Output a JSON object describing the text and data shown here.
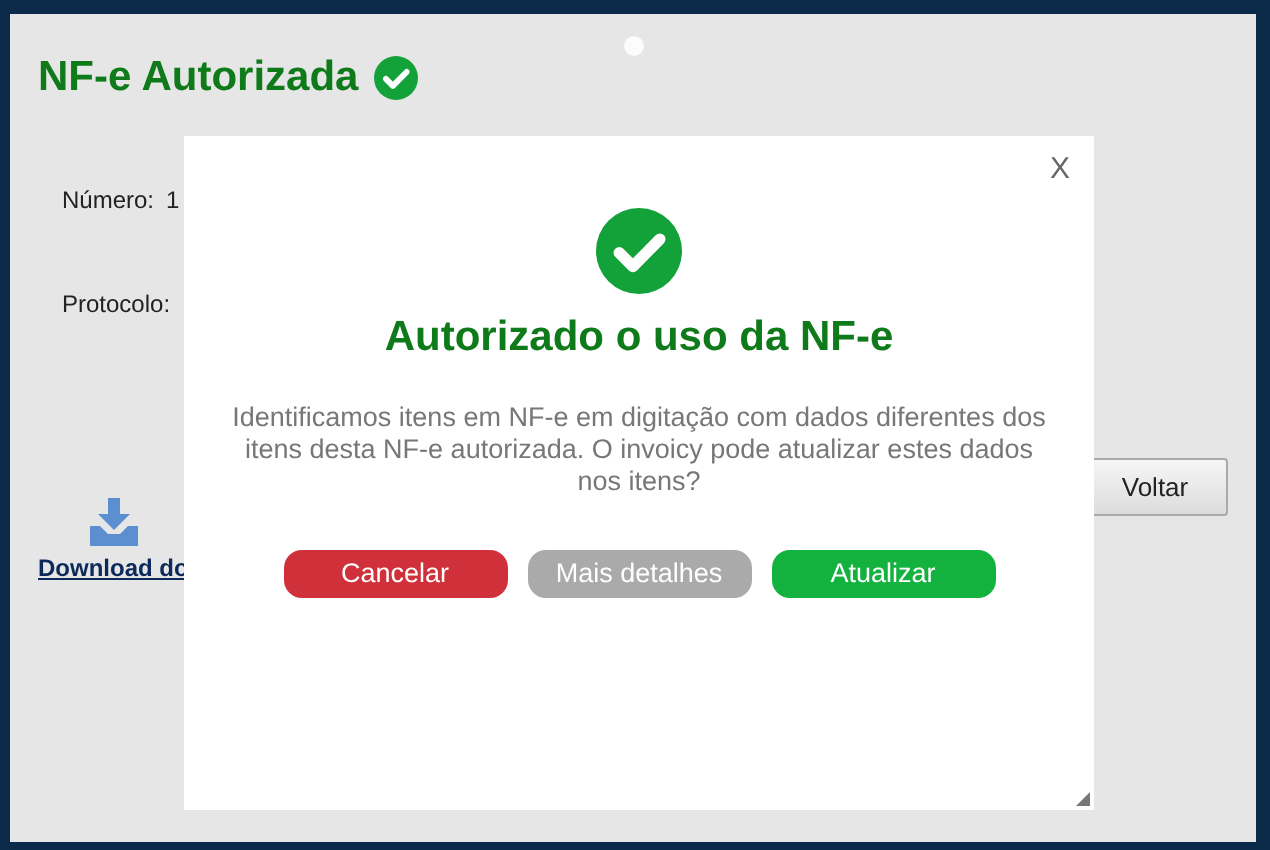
{
  "page": {
    "title": "NF-e Autorizada",
    "fields": [
      {
        "label": "Número:",
        "value": "1"
      },
      {
        "label": "Protocolo:"
      }
    ],
    "download_link": "Download do",
    "back_button": "Voltar"
  },
  "dialog": {
    "close": "X",
    "title": "Autorizado o uso da NF-e",
    "message": "Identificamos itens em NF-e em digitação com dados diferentes dos itens desta NF-e autorizada. O invoicy pode atualizar estes dados nos itens?",
    "buttons": [
      {
        "label": "Cancelar",
        "kind": "danger"
      },
      {
        "label": "Mais detalhes",
        "kind": "neutral"
      },
      {
        "label": "Atualizar",
        "kind": "success"
      }
    ]
  }
}
